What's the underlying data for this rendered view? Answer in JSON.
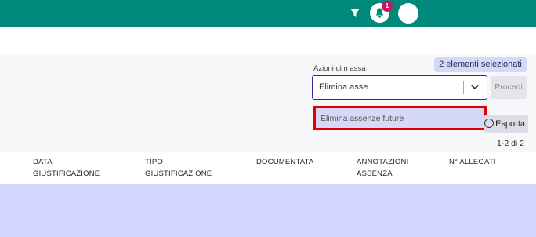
{
  "header": {
    "notification_count": "1"
  },
  "bulk_actions": {
    "selected_count_label": "2 elementi selezionati",
    "label": "Azioni di massa",
    "input_value": "Elimina asse",
    "proceed_label": "Procedi",
    "dropdown_option": "Elimina assenze future"
  },
  "toolbar": {
    "export_label": "Esporta",
    "pagination": "1-2 di 2"
  },
  "table": {
    "columns": [
      {
        "line1": "DATA",
        "line2": "GIUSTIFICAZIONE"
      },
      {
        "line1": "TIPO",
        "line2": "GIUSTIFICAZIONE"
      },
      {
        "line1": "",
        "line2": "DOCUMENTATA"
      },
      {
        "line1": "ANNOTAZIONI",
        "line2": "ASSENZA"
      },
      {
        "line1": "",
        "line2": "N° ALLEGATI"
      }
    ]
  },
  "colors": {
    "header_bg": "#00897b",
    "badge_bg": "#c2185b",
    "selected_bg": "#d6d8f7",
    "row_bg": "#d4d5fd",
    "highlight_border": "#e00000"
  }
}
